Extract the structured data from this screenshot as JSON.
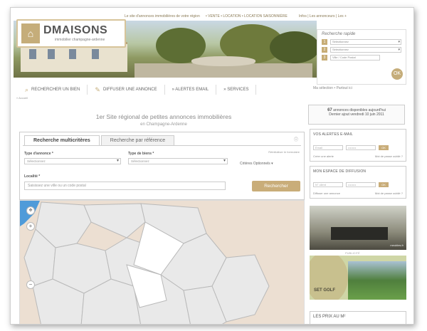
{
  "header": {
    "slogan": "Le site d'annonces immobilières de votre région",
    "top_links": "• VENTE • LOCATION • LOCATION SAISONNIÈRE",
    "account_links": "Infos  |  Les annonceurs  |  Les +",
    "logo_brand": "DMAISONS",
    "logo_sub": "immobilier champagne-ardenne"
  },
  "quick_search": {
    "title": "Recherche rapide",
    "select1": "Sélectionnez",
    "select2": "Sélectionnez",
    "city_placeholder": "Ville / Code Postal",
    "go_label": "OK"
  },
  "nav": {
    "items": [
      "RECHERCHER UN BIEN",
      "DIFFUSER UNE ANNONCE",
      "» ALERTES EMAIL",
      "» SERVICES"
    ]
  },
  "selection_bar": "Ma sélection  •  Partout ici",
  "breadcrumb": "» Accueil",
  "headline": {
    "line1": "1er Site régional de petites annonces immobilières",
    "line2": "en Champagne-Ardenne"
  },
  "annonces": {
    "count": "67",
    "text": "annonces disponibles aujourd'hui",
    "updated": "Dernier ajout vendredi 10 juin 2011"
  },
  "search": {
    "tabs": [
      "Recherche multicritères",
      "Recherche par référence"
    ],
    "type_annonce_label": "Type d'annonce *",
    "type_annonce_value": "Sélectionnez",
    "type_bien_label": "Type de biens *",
    "type_bien_value": "Sélectionnez",
    "reset": "Réinitialiser le formulaire",
    "criteres": "Critères Optionnels ▾",
    "localite_label": "Localité *",
    "localite_placeholder": "Saisissez une ville ou un code postal",
    "button": "Rechercher"
  },
  "alertes": {
    "title": "VOS ALERTES E-MAIL",
    "email_ph": "Email",
    "pass_ph": "••••••••",
    "ok": "OK",
    "create": "Créer une alerte",
    "forgot": "Mot de passe oublié ?"
  },
  "diffusion": {
    "title": "MON ESPACE DE DIFFUSION",
    "id_ph": "N° client",
    "pass_ph": "••••••••",
    "ok": "OK",
    "create": "Diffuser une annonce",
    "forgot": "Mot de passe oublié ?"
  },
  "ads": {
    "ad1_text": "meubles.fr",
    "pub_label": "PUBLICITÉ",
    "ad2_text": "SET GOLF"
  },
  "prix": {
    "title": "LES PRIX AU M²"
  },
  "colors": {
    "accent": "#c9ad79",
    "map_land": "#ecdfd2",
    "map_sea": "#4f9bd9"
  }
}
